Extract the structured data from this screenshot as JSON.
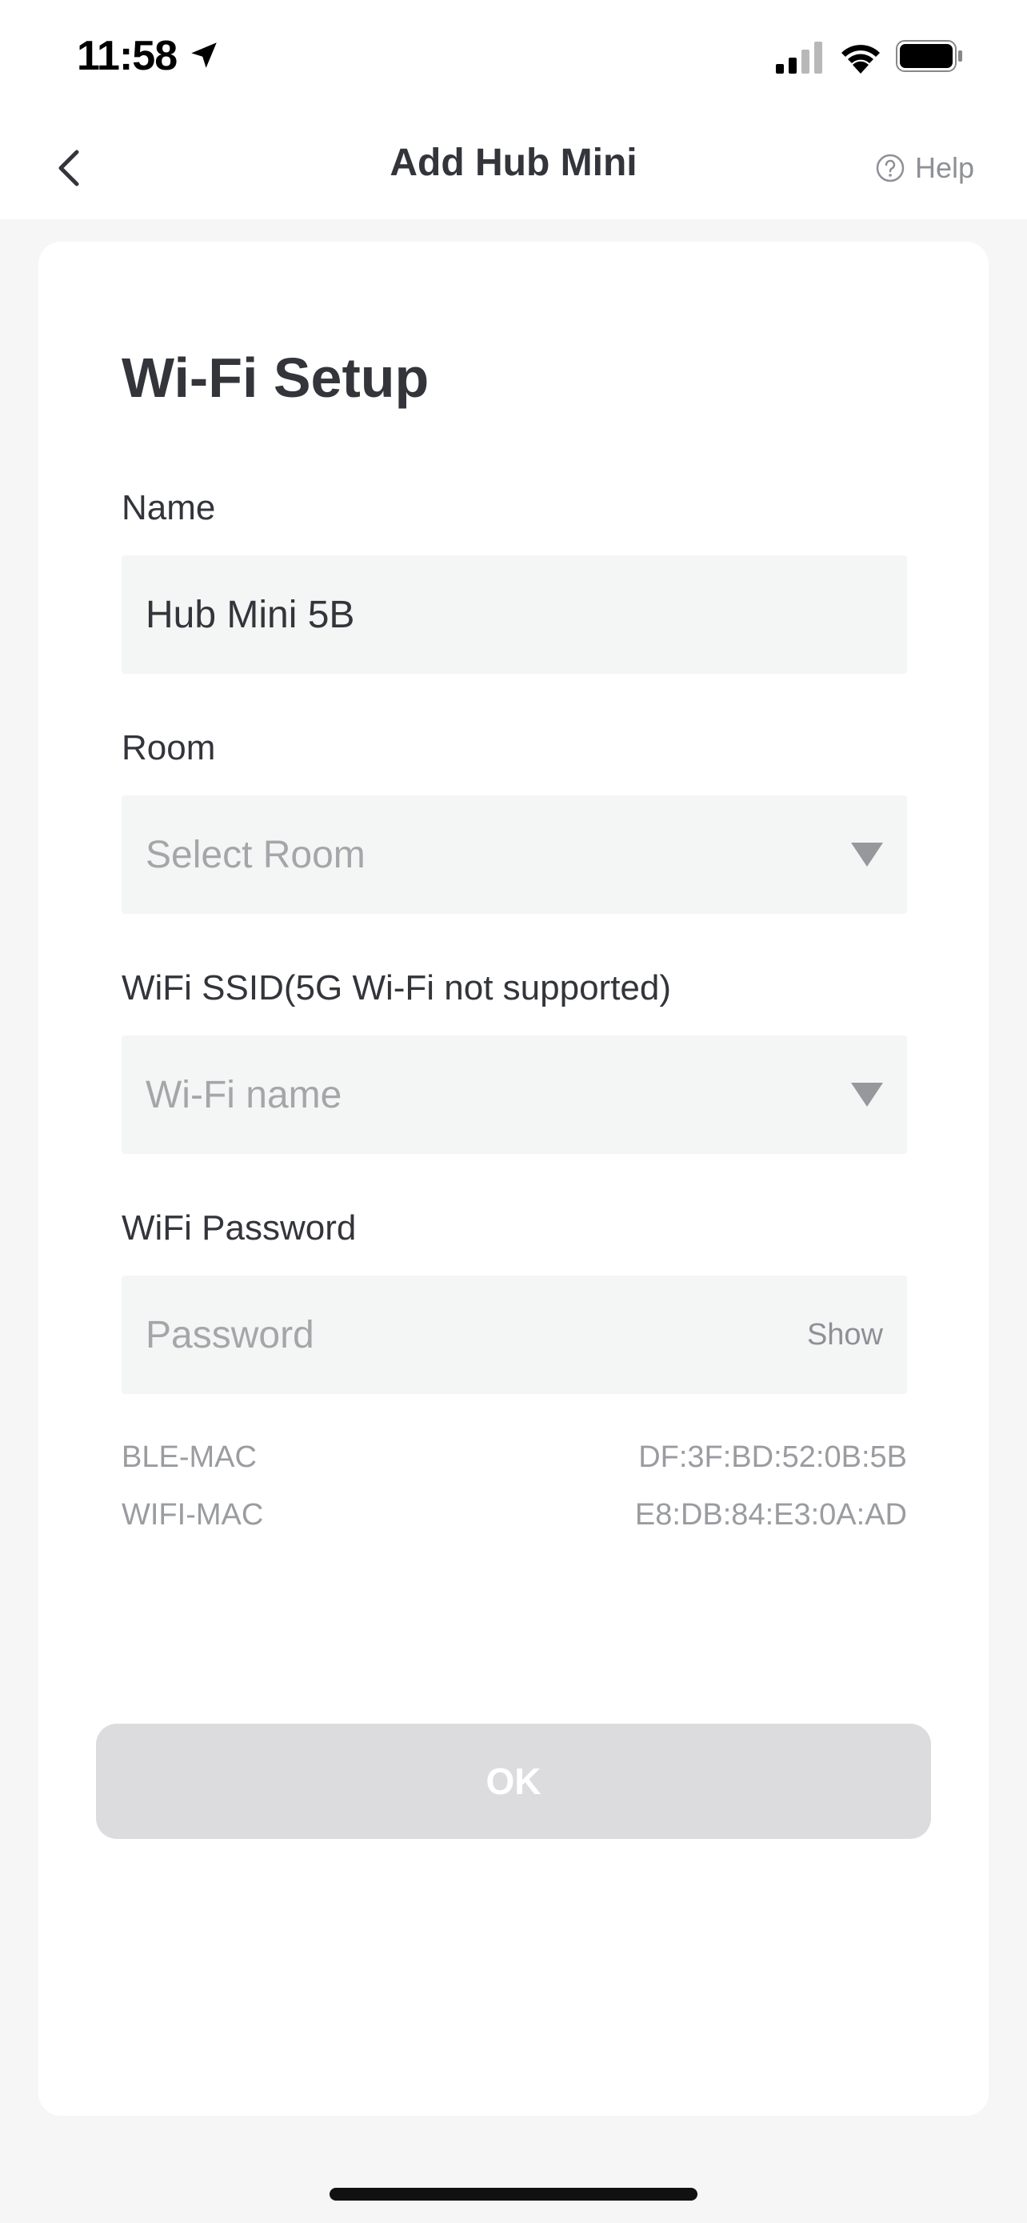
{
  "status_bar": {
    "time": "11:58",
    "icons": [
      "location-arrow-icon",
      "cellular-signal-icon",
      "wifi-icon",
      "battery-icon"
    ]
  },
  "nav": {
    "title": "Add Hub Mini",
    "help_label": "Help"
  },
  "form": {
    "section_title": "Wi-Fi Setup",
    "name": {
      "label": "Name",
      "value": "Hub Mini 5B"
    },
    "room": {
      "label": "Room",
      "placeholder": "Select Room"
    },
    "ssid": {
      "label": "WiFi SSID(5G Wi-Fi not supported)",
      "placeholder": "Wi-Fi name"
    },
    "password": {
      "label": "WiFi Password",
      "placeholder": "Password",
      "show_label": "Show"
    },
    "mac": {
      "ble_label": "BLE-MAC",
      "ble_value": "DF:3F:BD:52:0B:5B",
      "wifi_label": "WIFI-MAC",
      "wifi_value": "E8:DB:84:E3:0A:AD"
    },
    "ok_label": "OK"
  },
  "colors": {
    "text_primary": "#33353b",
    "text_muted": "#9a9ca0",
    "field_bg": "#f4f6f5",
    "button_disabled": "#dcdcde",
    "page_bg": "#f5f6f5"
  }
}
